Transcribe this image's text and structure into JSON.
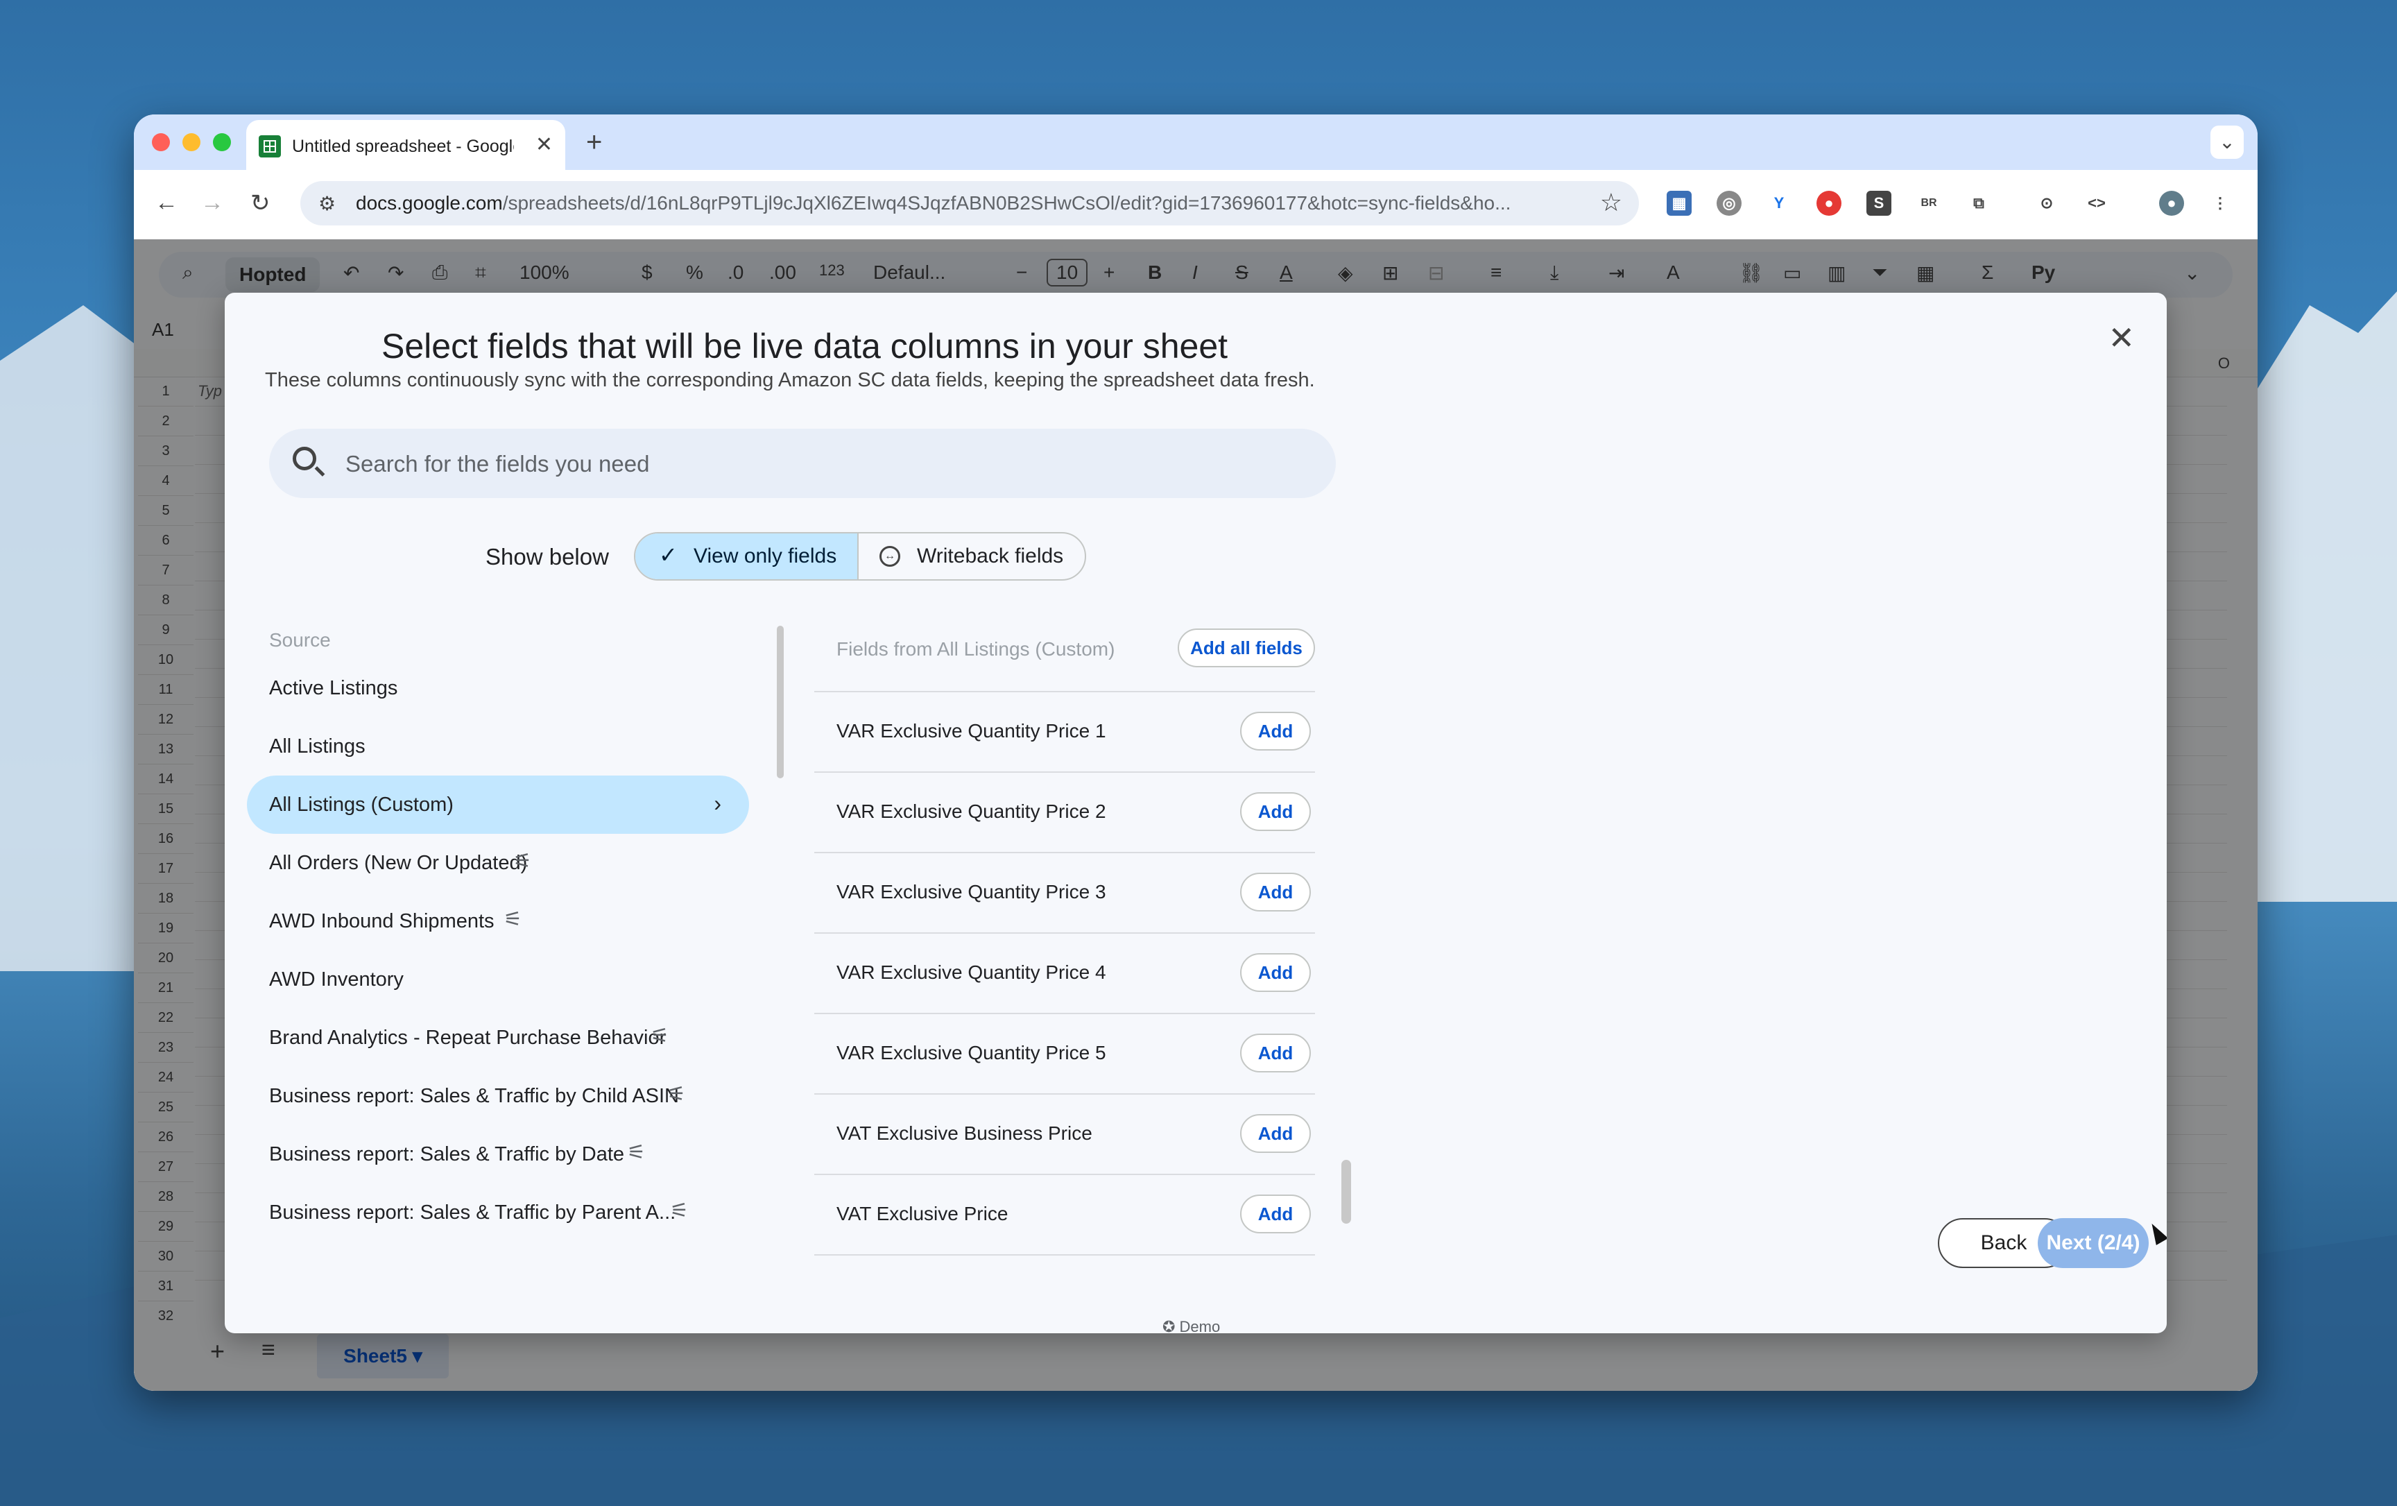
{
  "browser": {
    "tab_title": "Untitled spreadsheet - Google Sheets",
    "url_host": "docs.google.com",
    "url_path": "/spreadsheets/d/16nL8qrP9TLjl9cJqXl6ZEIwq4SJqzfABN0B2SHwCsOl/edit?gid=1736960177&hotc=sync-fields&ho..."
  },
  "sheet": {
    "zoom": "100%",
    "font": "Defaul...",
    "font_size": "10",
    "name_box": "A1",
    "active_tab": "Sheet5",
    "column_o": "O",
    "first_cell": "Typ",
    "extension_label": "Hopted",
    "rows": [
      "1",
      "2",
      "3",
      "4",
      "5",
      "6",
      "7",
      "8",
      "9",
      "10",
      "11",
      "12",
      "13",
      "14",
      "15",
      "16",
      "17",
      "18",
      "19",
      "20",
      "21",
      "22",
      "23",
      "24",
      "25",
      "26",
      "27",
      "28",
      "29",
      "30",
      "31",
      "32"
    ]
  },
  "modal": {
    "title": "Select fields that will be live data columns in your sheet",
    "subtitle": "These columns continuously sync with the corresponding Amazon SC data fields, keeping the spreadsheet data fresh.",
    "search_placeholder": "Search for the fields you need",
    "show_below": "Show below",
    "view_only": "View only fields",
    "writeback": "Writeback fields",
    "source_header": "Source",
    "sources": [
      {
        "label": "Active Listings",
        "filter": false
      },
      {
        "label": "All Listings",
        "filter": false
      },
      {
        "label": "All Listings (Custom)",
        "filter": false
      },
      {
        "label": "All Orders (New Or Updated)",
        "filter": true
      },
      {
        "label": "AWD Inbound Shipments",
        "filter": true
      },
      {
        "label": "AWD Inventory",
        "filter": false
      },
      {
        "label": "Brand Analytics - Repeat Purchase Behavior",
        "filter": true
      },
      {
        "label": "Business report: Sales & Traffic by Child ASIN",
        "filter": true
      },
      {
        "label": "Business report: Sales & Traffic by Date",
        "filter": true
      },
      {
        "label": "Business report: Sales & Traffic by Parent A...",
        "filter": true
      }
    ],
    "fields_header": "Fields from All Listings (Custom)",
    "add_all": "Add all fields",
    "add_label": "Add",
    "fields": [
      "VAR Exclusive Quantity Price 1",
      "VAR Exclusive Quantity Price 2",
      "VAR Exclusive Quantity Price 3",
      "VAR Exclusive Quantity Price 4",
      "VAR Exclusive Quantity Price 5",
      "VAT Exclusive Business Price",
      "VAT Exclusive Price"
    ],
    "back": "Back",
    "next": "Next (2/4)",
    "footer": "Demo"
  }
}
